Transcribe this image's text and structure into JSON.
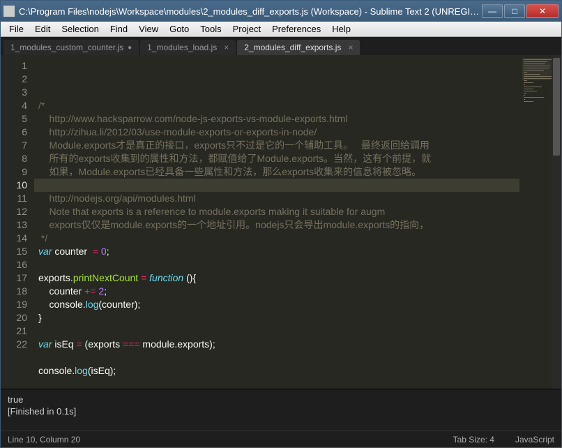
{
  "window": {
    "title": "C:\\Program Files\\nodejs\\Workspace\\modules\\2_modules_diff_exports.js (Workspace) - Sublime Text 2 (UNREGIST..."
  },
  "menu": {
    "items": [
      "File",
      "Edit",
      "Selection",
      "Find",
      "View",
      "Goto",
      "Tools",
      "Project",
      "Preferences",
      "Help"
    ]
  },
  "tabs": [
    {
      "label": "1_modules_custom_counter.js",
      "active": false,
      "dirty": true
    },
    {
      "label": "1_modules_load.js",
      "active": false,
      "dirty": false
    },
    {
      "label": "2_modules_diff_exports.js",
      "active": true,
      "dirty": false
    }
  ],
  "editor": {
    "current_line_number": 10,
    "lines": [
      {
        "n": 1,
        "tokens": [
          [
            "c-comment",
            "/*"
          ]
        ]
      },
      {
        "n": 2,
        "tokens": [
          [
            "c-comment",
            "    http://www.hacksparrow.com/node-js-exports-vs-module-exports.html"
          ]
        ]
      },
      {
        "n": 3,
        "tokens": [
          [
            "c-comment",
            "    http://zihua.li/2012/03/use-module-exports-or-exports-in-node/"
          ]
        ]
      },
      {
        "n": 4,
        "tokens": [
          [
            "c-comment",
            "    Module.exports才是真正的接口，exports只不过是它的一个辅助工具。   最终返回给调用"
          ]
        ]
      },
      {
        "n": 5,
        "tokens": [
          [
            "c-comment",
            "    所有的exports收集到的属性和方法，都赋值给了Module.exports。当然，这有个前提，就"
          ]
        ]
      },
      {
        "n": 6,
        "tokens": [
          [
            "c-comment",
            "    如果，Module.exports已经具备一些属性和方法，那么exports收集来的信息将被忽略。"
          ]
        ]
      },
      {
        "n": 7,
        "tokens": [
          [
            "",
            ""
          ]
        ]
      },
      {
        "n": 8,
        "tokens": [
          [
            "c-comment",
            "    http://nodejs.org/api/modules.html"
          ]
        ]
      },
      {
        "n": 9,
        "tokens": [
          [
            "c-comment",
            "    Note that exports is a reference to module.exports making it suitable for augm"
          ]
        ]
      },
      {
        "n": 10,
        "tokens": [
          [
            "c-comment",
            "    exports仅仅是module.exports的一个地址引用。nodejs只会导出module.exports的指向，"
          ]
        ]
      },
      {
        "n": 11,
        "tokens": [
          [
            "c-comment",
            " */"
          ]
        ]
      },
      {
        "n": 12,
        "tokens": [
          [
            "c-storage",
            "var "
          ],
          [
            "",
            "counter  "
          ],
          [
            "c-keyword",
            "="
          ],
          [
            "",
            " "
          ],
          [
            "c-num",
            "0"
          ],
          [
            "",
            ";"
          ]
        ]
      },
      {
        "n": 13,
        "tokens": [
          [
            "",
            ""
          ]
        ]
      },
      {
        "n": 14,
        "tokens": [
          [
            "",
            "exports."
          ],
          [
            "c-name",
            "printNextCount"
          ],
          [
            "",
            " "
          ],
          [
            "c-keyword",
            "="
          ],
          [
            "",
            " "
          ],
          [
            "c-storage",
            "function"
          ],
          [
            "",
            " (){"
          ]
        ]
      },
      {
        "n": 15,
        "tokens": [
          [
            "",
            "    counter "
          ],
          [
            "c-keyword",
            "+="
          ],
          [
            "",
            " "
          ],
          [
            "c-num",
            "2"
          ],
          [
            "",
            ";"
          ]
        ]
      },
      {
        "n": 16,
        "tokens": [
          [
            "",
            "    console."
          ],
          [
            "c-func",
            "log"
          ],
          [
            "",
            "(counter);"
          ]
        ]
      },
      {
        "n": 17,
        "tokens": [
          [
            "",
            "}"
          ]
        ]
      },
      {
        "n": 18,
        "tokens": [
          [
            "",
            ""
          ]
        ]
      },
      {
        "n": 19,
        "tokens": [
          [
            "c-storage",
            "var "
          ],
          [
            "",
            "isEq "
          ],
          [
            "c-keyword",
            "="
          ],
          [
            "",
            " (exports "
          ],
          [
            "c-keyword",
            "==="
          ],
          [
            "",
            " module.exports);"
          ]
        ]
      },
      {
        "n": 20,
        "tokens": [
          [
            "",
            ""
          ]
        ]
      },
      {
        "n": 21,
        "tokens": [
          [
            "",
            "console."
          ],
          [
            "c-func",
            "log"
          ],
          [
            "",
            "(isEq);"
          ]
        ]
      },
      {
        "n": 22,
        "tokens": [
          [
            "",
            ""
          ]
        ]
      }
    ]
  },
  "console": {
    "lines": [
      "true",
      "[Finished in 0.1s]"
    ]
  },
  "status": {
    "position": "Line 10, Column 20",
    "tabsize": "Tab Size: 4",
    "syntax": "JavaScript"
  }
}
